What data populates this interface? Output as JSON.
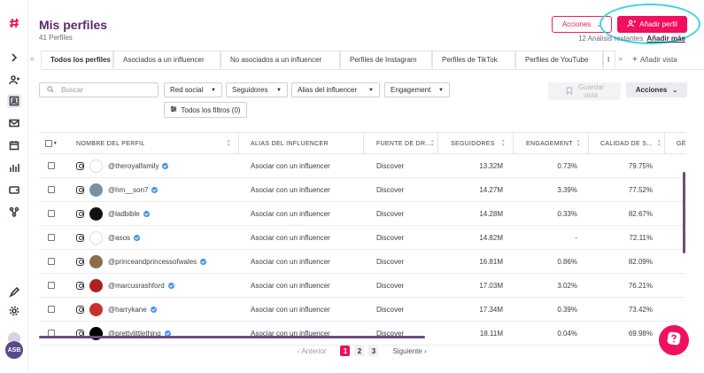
{
  "header": {
    "title": "Mis perfiles",
    "subtitle": "41 Perfiles",
    "actions_label": "Acciones",
    "add_profile_label": "Añadir perfil",
    "quota_text": "12 Análisis restantes",
    "quota_link": "Añadir más"
  },
  "tabs": [
    {
      "label": "Todos los perfiles"
    },
    {
      "label": "Asociados a un influencer"
    },
    {
      "label": "No asociados a un influencer"
    },
    {
      "label": "Perfiles de Instagram"
    },
    {
      "label": "Perfiles de TikTok"
    },
    {
      "label": "Perfiles de YouTube"
    },
    {
      "label": "I"
    }
  ],
  "add_view_label": "Añadir vista",
  "filters": {
    "search_placeholder": "Buscar",
    "red_social": "Red social",
    "seguidores": "Seguidores",
    "alias": "Alias del influencer",
    "engagement": "Engagement",
    "all_filters": "Todos los filtros (0)",
    "save_view": "Guardar vista",
    "actions": "Acciones"
  },
  "table": {
    "columns": [
      "NOMBRE DEL PERFIL",
      "ALIAS DEL INFLUENCER",
      "FUENTE DE DR...",
      "SEGUIDORES",
      "ENGAGEMENT",
      "CALIDAD DE S...",
      "GÉ"
    ],
    "rows": [
      {
        "handle": "@theroyalfamily",
        "alias": "Asociar con un influencer",
        "source": "Discover",
        "followers": "13.32M",
        "engagement": "0.73%",
        "quality": "79.75%",
        "avatar_color": "#ffffff"
      },
      {
        "handle": "@hm__son7",
        "alias": "Asociar con un influencer",
        "source": "Discover",
        "followers": "14.27M",
        "engagement": "3.39%",
        "quality": "77.52%",
        "avatar_color": "#7a8fa6"
      },
      {
        "handle": "@ladbible",
        "alias": "Asociar con un influencer",
        "source": "Discover",
        "followers": "14.28M",
        "engagement": "0.33%",
        "quality": "82.67%",
        "avatar_color": "#111111"
      },
      {
        "handle": "@asos",
        "alias": "Asociar con un influencer",
        "source": "Discover",
        "followers": "14.82M",
        "engagement": "-",
        "quality": "72.11%",
        "avatar_color": "#ffffff"
      },
      {
        "handle": "@princeandprincessofwales",
        "alias": "Asociar con un influencer",
        "source": "Discover",
        "followers": "16.81M",
        "engagement": "0.86%",
        "quality": "82.09%",
        "avatar_color": "#8a6e4b"
      },
      {
        "handle": "@marcusrashford",
        "alias": "Asociar con un influencer",
        "source": "Discover",
        "followers": "17.03M",
        "engagement": "3.02%",
        "quality": "76.21%",
        "avatar_color": "#b0201e"
      },
      {
        "handle": "@harrykane",
        "alias": "Asociar con un influencer",
        "source": "Discover",
        "followers": "17.34M",
        "engagement": "0.39%",
        "quality": "73.42%",
        "avatar_color": "#c83030"
      },
      {
        "handle": "@prettylittlething",
        "alias": "Asociar con un influencer",
        "source": "Discover",
        "followers": "18.11M",
        "engagement": "0.04%",
        "quality": "69.98%",
        "avatar_color": "#000000"
      }
    ]
  },
  "pagination": {
    "prev": "Anterior",
    "next": "Siguiente",
    "pages": [
      "1",
      "2",
      "3"
    ],
    "current": "1"
  },
  "user": {
    "initials": "ASB"
  },
  "colors": {
    "brand": "#f0105e",
    "title": "#5a2a6e",
    "highlight": "#3ad4e0"
  }
}
